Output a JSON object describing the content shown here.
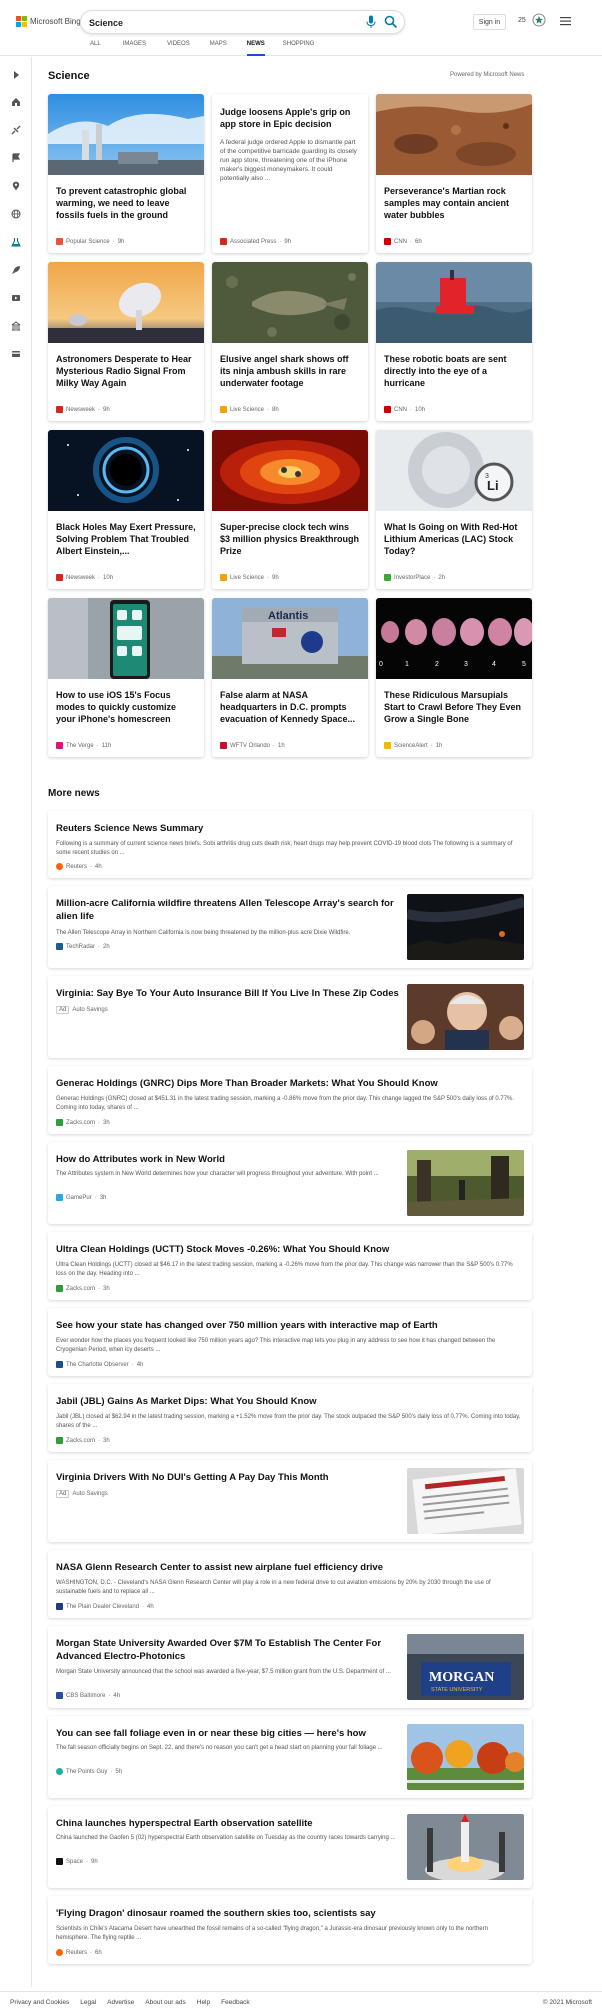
{
  "header": {
    "logo_text": "Microsoft Bing",
    "search_value": "Science",
    "signin_label": "Sign in",
    "rewards_count": "25",
    "tabs": [
      {
        "label": "ALL"
      },
      {
        "label": "IMAGES"
      },
      {
        "label": "VIDEOS"
      },
      {
        "label": "MAPS"
      },
      {
        "label": "NEWS"
      },
      {
        "label": "SHOPPING"
      }
    ],
    "active_tab": "NEWS"
  },
  "science": {
    "title": "Science",
    "powered_by": "Powered by Microsoft News",
    "cards": [
      {
        "title": "To prevent catastrophic global warming, we need to leave fossils fuels in the ground",
        "source": "Popular Science",
        "time": "9h",
        "logo_color": "#e8533b"
      },
      {
        "title": "Judge loosens Apple's grip on app store in Epic decision",
        "snippet": "A federal judge ordered Apple to dismantle part of the competitive barricade guarding its closely run app store, threatening one of the iPhone maker's biggest moneymakers. It could potentially also ...",
        "source": "Associated Press",
        "time": "9h",
        "logo_color": "#d9261c"
      },
      {
        "title": "Perseverance's Martian rock samples may contain ancient water bubbles",
        "source": "CNN",
        "time": "6h",
        "logo_color": "#cc0000"
      },
      {
        "title": "Astronomers Desperate to Hear Mysterious Radio Signal From Milky Way Again",
        "source": "Newsweek",
        "time": "9h",
        "logo_color": "#d8261f"
      },
      {
        "title": "Elusive angel shark shows off its ninja ambush skills in rare underwater footage",
        "source": "Live Science",
        "time": "8h",
        "logo_color": "#f0a30a"
      },
      {
        "title": "These robotic boats are sent directly into the eye of a hurricane",
        "source": "CNN",
        "time": "10h",
        "logo_color": "#cc0000"
      },
      {
        "title": "Black Holes May Exert Pressure, Solving Problem That Troubled Albert Einstein,...",
        "source": "Newsweek",
        "time": "10h",
        "logo_color": "#d8261f"
      },
      {
        "title": "Super-precise clock tech wins $3 million physics Breakthrough Prize",
        "source": "Live Science",
        "time": "9h",
        "logo_color": "#f0a30a"
      },
      {
        "title": "What Is Going on With Red-Hot Lithium Americas (LAC) Stock Today?",
        "source": "InvestorPlace",
        "time": "2h",
        "logo_color": "#3aaa35"
      },
      {
        "title": "How to use iOS 15's Focus modes to quickly customize your iPhone's homescreen",
        "source": "The Verge",
        "time": "11h",
        "logo_color": "#e2127a"
      },
      {
        "title": "False alarm at NASA headquarters in D.C. prompts evacuation of Kennedy Space...",
        "source": "WFTV Orlando",
        "time": "1h",
        "logo_color": "#c8102e"
      },
      {
        "title": "These Ridiculous Marsupials Start to Crawl Before They Even Grow a Single Bone",
        "source": "ScienceAlert",
        "time": "1h",
        "logo_color": "#f2b705"
      }
    ],
    "image_labels": {
      "atlantis": "Atlantis",
      "lithium_symbol": "3",
      "lithium_letters": "Li",
      "embryo_numbers": [
        "0",
        "1",
        "2",
        "3",
        "4",
        "5"
      ]
    }
  },
  "more_news": {
    "title": "More news",
    "items": [
      {
        "title": "Reuters Science News Summary",
        "snippet": "Following is a summary of current science news briefs. Sobi arthritis drug cuts death risk; heart drugs may help prevent COVID-19 blood clots The following is a summary of some recent studies on ...",
        "source": "Reuters",
        "time": "4h",
        "logo_color": "#fa6400"
      },
      {
        "title": "Million-acre California wildfire threatens Allen Telescope Array's search for alien life",
        "snippet": "The Allen Telescope Array in Northern California is now being threatened by the million-plus acre Dixie Wildfire.",
        "source": "TechRadar",
        "time": "2h",
        "logo_color": "#1d5d90"
      },
      {
        "title": "Virginia: Say Bye To Your Auto Insurance Bill If You Live In These Zip Codes",
        "ad_label": "Ad",
        "source": "Auto Savings"
      },
      {
        "title": "Generac Holdings (GNRC) Dips More Than Broader Markets: What You Should Know",
        "snippet": "Generac Holdings (GNRC) closed at $451.31 in the latest trading session, marking a -0.86% move from the prior day. This change lagged the S&P 500's daily loss of 0.77%. Coming into today, shares of ...",
        "source": "Zacks.com",
        "time": "3h",
        "logo_color": "#2e9e3c"
      },
      {
        "title": "How do Attributes work in New World",
        "snippet": "The Attributes system in New World determines how your character will progress throughout your adventure. With point ...",
        "source": "GamePur",
        "time": "3h",
        "logo_color": "#2aa8e0"
      },
      {
        "title": "Ultra Clean Holdings (UCTT) Stock Moves -0.26%: What You Should Know",
        "snippet": "Ultra Clean Holdings (UCTT) closed at $46.17 in the latest trading session, marking a -0.26% move from the prior day. This change was narrower than the S&P 500's 0.77% loss on the day. Heading into ...",
        "source": "Zacks.com",
        "time": "3h",
        "logo_color": "#2e9e3c"
      },
      {
        "title": "See how your state has changed over 750 million years with interactive map of Earth",
        "snippet": "Ever wonder how the places you frequent looked like 750 million years ago? This interactive map lets you plug in any address to see how it has changed between the Cryogenian Period, when icy deserts ...",
        "source": "The Charlotte Observer",
        "time": "4h",
        "logo_color": "#1a4f8a"
      },
      {
        "title": "Jabil (JBL) Gains As Market Dips: What You Should Know",
        "snippet": "Jabil (JBL) closed at $62.94 in the latest trading session, marking a +1.52% move from the prior day. The stock outpaced the S&P 500's daily loss of 0.77%. Coming into today, shares of the ...",
        "source": "Zacks.com",
        "time": "3h",
        "logo_color": "#2e9e3c"
      },
      {
        "title": "Virginia Drivers With No DUI's Getting A Pay Day This Month",
        "ad_label": "Ad",
        "source": "Auto Savings"
      },
      {
        "title": "NASA Glenn Research Center to assist new airplane fuel efficiency drive",
        "snippet": "WASHINGTON, D.C. - Cleveland's NASA Glenn Research Center will play a role in a new federal drive to cut aviation emissions by 20% by 2030 through the use of sustainable fuels and to replace all ...",
        "source": "The Plain Dealer Cleveland",
        "time": "4h",
        "logo_color": "#1f3d7a"
      },
      {
        "title": "Morgan State University Awarded Over $7M To Establish The Center For Advanced Electro-Photonics",
        "snippet": "Morgan State University announced that the school was awarded a five-year, $7.5 million grant from the U.S. Department of ...",
        "source": "CBS Baltimore",
        "time": "4h",
        "logo_color": "#2b4b9b"
      },
      {
        "title": "You can see fall foliage even in or near these big cities — here's how",
        "snippet": "The fall season officially begins on Sept. 22, and there's no reason you can't get a head start on planning your fall foliage ...",
        "source": "The Points Guy",
        "time": "5h",
        "logo_color": "#1ab0a6"
      },
      {
        "title": "China launches hyperspectral Earth observation satellite",
        "snippet": "China launched the Gaofen 5 (02) hyperspectral Earth observation satellite on Tuesday as the country races towards carrying ...",
        "source": "Space",
        "time": "9h",
        "logo_color": "#111111"
      },
      {
        "title": "'Flying Dragon' dinosaur roamed the southern skies too, scientists say",
        "snippet": "Scientists in Chile's Atacama Desert have unearthed the fossil remains of a so-called \"flying dragon,\" a Jurassic-era dinosaur previously known only to the northern hemisphere. The flying reptile ...",
        "source": "Reuters",
        "time": "6h",
        "logo_color": "#fa6400"
      }
    ],
    "thumb_labels": {
      "morgan": "MORGAN",
      "morgan_sub": "STATE UNIVERSITY"
    }
  },
  "footer": {
    "links": [
      "Privacy and Cookies",
      "Legal",
      "Advertise",
      "About our ads",
      "Help",
      "Feedback"
    ],
    "copyright": "© 2021 Microsoft"
  },
  "icons": [
    "microsoft-logo",
    "mic-icon",
    "search-icon",
    "rewards-icon",
    "hamburger-menu-icon",
    "expand-arrow-icon",
    "home-icon",
    "sports-icon",
    "flag-icon",
    "location-icon",
    "globe-icon",
    "science-icon",
    "rocket-icon",
    "video-icon",
    "building-icon",
    "card-icon"
  ],
  "colors": {
    "accent": "#174ae4",
    "bing_blue": "#007daa"
  }
}
